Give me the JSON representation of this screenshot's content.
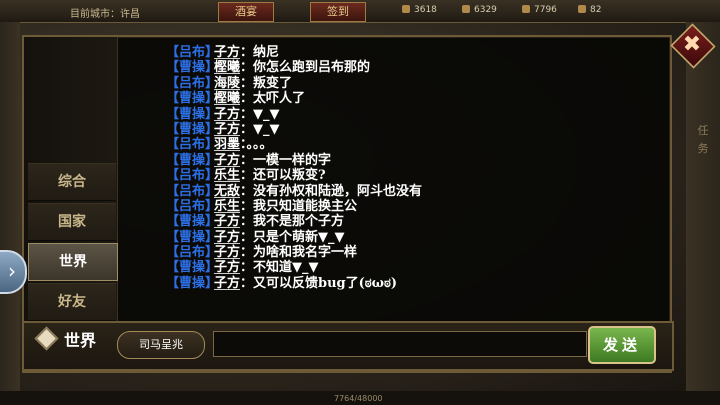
{
  "topbar": {
    "city": "目前城市：许昌",
    "tab1": "酒宴",
    "tab2": "签到",
    "resources": [
      "3618",
      "6329",
      "7796",
      "82"
    ]
  },
  "right_side": [
    "任",
    "务",
    "务"
  ],
  "bottom": {
    "text": "7764/48000"
  },
  "sidebar": {
    "tabs": [
      {
        "label": "综合",
        "active": false
      },
      {
        "label": "国家",
        "active": false
      },
      {
        "label": "世界",
        "active": true
      },
      {
        "label": "好友",
        "active": false
      }
    ]
  },
  "messages": [
    {
      "faction": "【吕布】",
      "name": "子方",
      "text": "：纳尼"
    },
    {
      "faction": "【曹操】",
      "name": "樫曦",
      "text": "：你怎么跑到吕布那的"
    },
    {
      "faction": "【吕布】",
      "name": "海陵",
      "text": "：叛变了"
    },
    {
      "faction": "【曹操】",
      "name": "樫曦",
      "text": "：太吓人了"
    },
    {
      "faction": "【曹操】",
      "name": "子方",
      "text": "：▼_▼"
    },
    {
      "faction": "【曹操】",
      "name": "子方",
      "text": "：▼_▼"
    },
    {
      "faction": "【吕布】",
      "name": "羽墨",
      "text": "：。。。"
    },
    {
      "faction": "【曹操】",
      "name": "子方",
      "text": "：一模一样的字"
    },
    {
      "faction": "【吕布】",
      "name": "乐生",
      "text": "：还可以叛变?"
    },
    {
      "faction": "【吕布】",
      "name": "无敌",
      "text": "：没有孙权和陆逊，阿斗也没有"
    },
    {
      "faction": "【吕布】",
      "name": "乐生",
      "text": "：我只知道能换主公"
    },
    {
      "faction": "【曹操】",
      "name": "子方",
      "text": "：我不是那个子方"
    },
    {
      "faction": "【曹操】",
      "name": "子方",
      "text": "：只是个萌新▼_▼"
    },
    {
      "faction": "【吕布】",
      "name": "子方",
      "text": "：为啥和我名字一样"
    },
    {
      "faction": "【曹操】",
      "name": "子方",
      "text": "：不知道▼_▼"
    },
    {
      "faction": "【曹操】",
      "name": "子方",
      "text": "：又可以反馈bug了(ಠωಠ)"
    }
  ],
  "input": {
    "channel": "世界",
    "target": "司马呈兆",
    "value": "",
    "send_label": "发送"
  },
  "colors": {
    "faction": "#2c6fe6",
    "send": "#5b9a36"
  }
}
